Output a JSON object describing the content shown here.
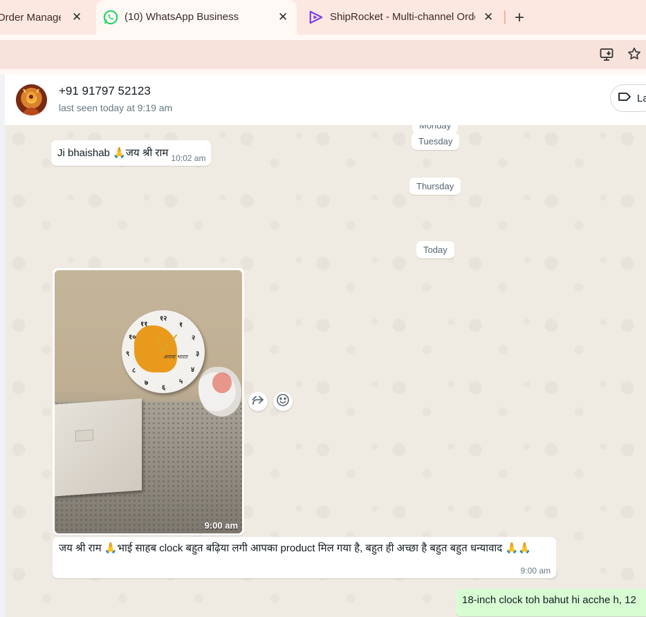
{
  "browser": {
    "tabs": [
      {
        "title": "Order Management",
        "active": false,
        "close": "✕"
      },
      {
        "title": "(10) WhatsApp Business",
        "active": true,
        "close": "✕"
      },
      {
        "title": "ShipRocket - Multi-channel Order",
        "active": false,
        "close": "✕"
      }
    ],
    "new_tab": "+",
    "icons": [
      "install-app-icon",
      "bookmark-star-icon"
    ]
  },
  "chat": {
    "contact_name": "+91 91797 52123",
    "last_seen": "last seen today at 9:19 am",
    "label_button": "La"
  },
  "dates": {
    "partial": "Monday",
    "tuesday": "Tuesday",
    "thursday": "Thursday",
    "today": "Today"
  },
  "messages": [
    {
      "direction": "in",
      "type": "text",
      "text": "Ji bhaishab 🙏जय श्री राम",
      "time": "10:02 am"
    },
    {
      "direction": "in",
      "type": "image",
      "time": "9:00 am",
      "image": "photo of a round wall clock with an orange India map design on a bed",
      "clock_numerals": [
        "१२",
        "१",
        "२",
        "३",
        "४",
        "५",
        "६",
        "७",
        "८",
        "९",
        "१०",
        "११"
      ],
      "clock_brand": "अपना भारत"
    },
    {
      "direction": "in",
      "type": "text",
      "text": "जय श्री राम 🙏भाई साहब clock बहुत बढ़िया लगी आपका product मिल गया है, बहुत ही अच्छा है बहुत बहुत धन्यावाद 🙏🙏",
      "time": "9:00 am"
    },
    {
      "direction": "out",
      "type": "text",
      "text": "18-inch clock toh bahut hi acche h, 12"
    }
  ],
  "colors": {
    "tab_strip": "#fde8e1",
    "chat_bg": "#efeae2",
    "outgoing_bubble": "#d9fdd3",
    "incoming_bubble": "#ffffff",
    "whatsapp_green": "#25d366",
    "shiprocket_purple": "#7b3fe4"
  }
}
